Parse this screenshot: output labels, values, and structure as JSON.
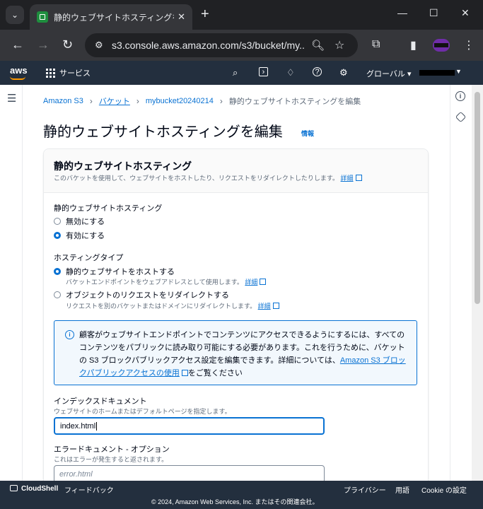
{
  "browser": {
    "tab_title": "静的ウェブサイトホスティングを編集",
    "tab_close": "✕",
    "new_tab": "+",
    "url": "s3.console.aws.amazon.com/s3/bucket/my...",
    "controls": {
      "minimize": "—",
      "maximize": "☐",
      "close": "✕"
    }
  },
  "aws_header": {
    "logo": "aws",
    "services_label": "サービス",
    "region_label": "グローバル ▾"
  },
  "breadcrumb": {
    "items": [
      "Amazon S3",
      "バケット",
      "mybucket20240214"
    ],
    "current": "静的ウェブサイトホスティングを編集",
    "separator": "›"
  },
  "page": {
    "title": "静的ウェブサイトホスティングを編集",
    "info_link": "情報"
  },
  "panel": {
    "title": "静的ウェブサイトホスティング",
    "description": "このバケットを使用して、ウェブサイトをホストしたり、リクエストをリダイレクトしたりします。",
    "detail_link": "詳細",
    "hosting_label": "静的ウェブサイトホスティング",
    "hosting_options": [
      {
        "label": "無効にする",
        "selected": false
      },
      {
        "label": "有効にする",
        "selected": true
      }
    ],
    "hosting_type_label": "ホスティングタイプ",
    "hosting_types": [
      {
        "label": "静的ウェブサイトをホストする",
        "description": "バケットエンドポイントをウェブアドレスとして使用します。",
        "link": "詳細",
        "selected": true
      },
      {
        "label": "オブジェクトのリクエストをリダイレクトする",
        "description": "リクエストを別のバケットまたはドメインにリダイレクトします。",
        "link": "詳細",
        "selected": false
      }
    ],
    "alert": {
      "text_before": "顧客がウェブサイトエンドポイントでコンテンツにアクセスできるようにするには、すべてのコンテンツをパブリックに読み取り可能にする必要があります。これを行うために、バケットの S3 ブロックパブリックアクセス設定を編集できます。詳細については、",
      "link": "Amazon S3 ブロックパブリックアクセスの使用",
      "text_after": "をご覧ください"
    },
    "index_doc": {
      "label": "インデックスドキュメント",
      "description": "ウェブサイトのホームまたはデフォルトページを指定します。",
      "value": "index.html"
    },
    "error_doc": {
      "label": "エラードキュメント - オプション",
      "description": "これはエラーが発生すると返されます。",
      "placeholder": "error.html"
    }
  },
  "footer": {
    "cloudshell": "CloudShell",
    "feedback": "フィードバック",
    "privacy": "プライバシー",
    "terms": "用語",
    "cookie": "Cookie の設定",
    "copyright": "© 2024, Amazon Web Services, Inc. またはその関連会社。"
  }
}
